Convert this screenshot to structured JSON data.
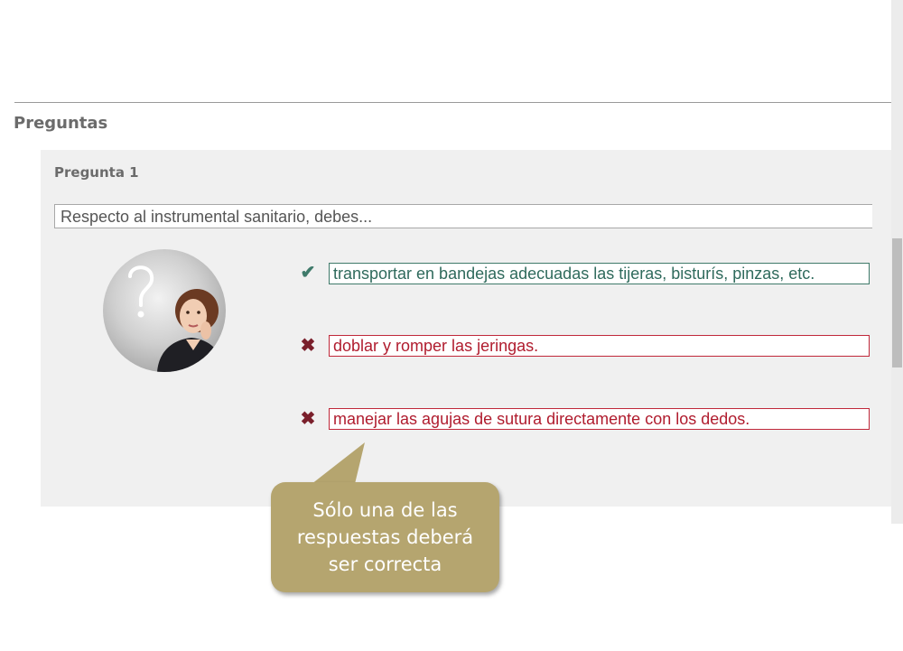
{
  "section": {
    "title": "Preguntas"
  },
  "question": {
    "label": "Pregunta 1",
    "text": "Respecto al instrumental sanitario, debes..."
  },
  "answers": [
    {
      "icon": "check-icon",
      "status": "correct",
      "text": "transportar en bandejas adecuadas las tijeras, bisturís, pinzas, etc."
    },
    {
      "icon": "x-icon",
      "status": "incorrect",
      "text": "doblar y romper las jeringas."
    },
    {
      "icon": "x-icon",
      "status": "incorrect",
      "text": "manejar las agujas de sutura directamente con los dedos."
    }
  ],
  "callout": {
    "lines": [
      "Sólo una de las",
      "respuestas deberá",
      "ser correcta"
    ]
  },
  "colors": {
    "correct": "#3f7a6a",
    "incorrect": "#c0283a",
    "callout": "#b5a56f",
    "panel": "#f0f0f0"
  }
}
